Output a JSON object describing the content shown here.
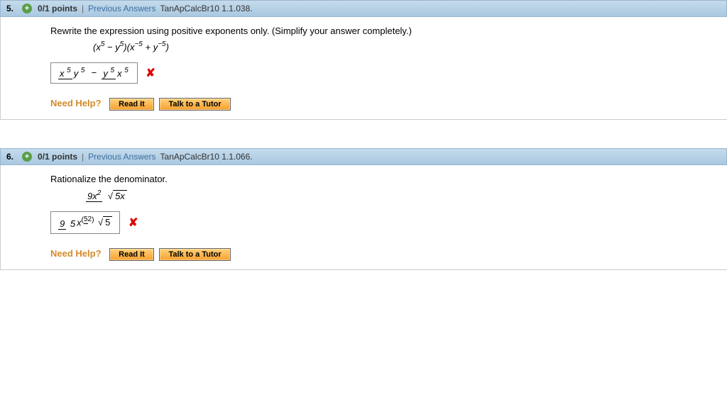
{
  "q5": {
    "number": "5.",
    "points": "0/1 points",
    "prev": "Previous Answers",
    "source": "TanApCalcBr10 1.1.038.",
    "prompt": "Rewrite the expression using positive exponents only. (Simplify your answer completely.)",
    "expression_html": "(x<sup>5</sup> − y<sup>5</sup>)(x<sup>−5</sup> + y<sup>−5</sup>)",
    "answer_html": "x<sup>5</sup>/y<sup>5</sup> − y<sup>5</sup>/x<sup>5</sup>",
    "wrong": "✘",
    "need_help": "Need Help?",
    "read": "Read It",
    "tutor": "Talk to a Tutor"
  },
  "q6": {
    "number": "6.",
    "points": "0/1 points",
    "prev": "Previous Answers",
    "source": "TanApCalcBr10 1.1.066.",
    "prompt": "Rationalize the denominator.",
    "expr_top": "9x²",
    "expr_bot_rad": "5x",
    "ans_coef_top": "9",
    "ans_coef_bot": "5",
    "ans_pow_top": "5",
    "ans_pow_bot": "2",
    "ans_rad": "5",
    "wrong": "✘",
    "need_help": "Need Help?",
    "read": "Read It",
    "tutor": "Talk to a Tutor"
  }
}
